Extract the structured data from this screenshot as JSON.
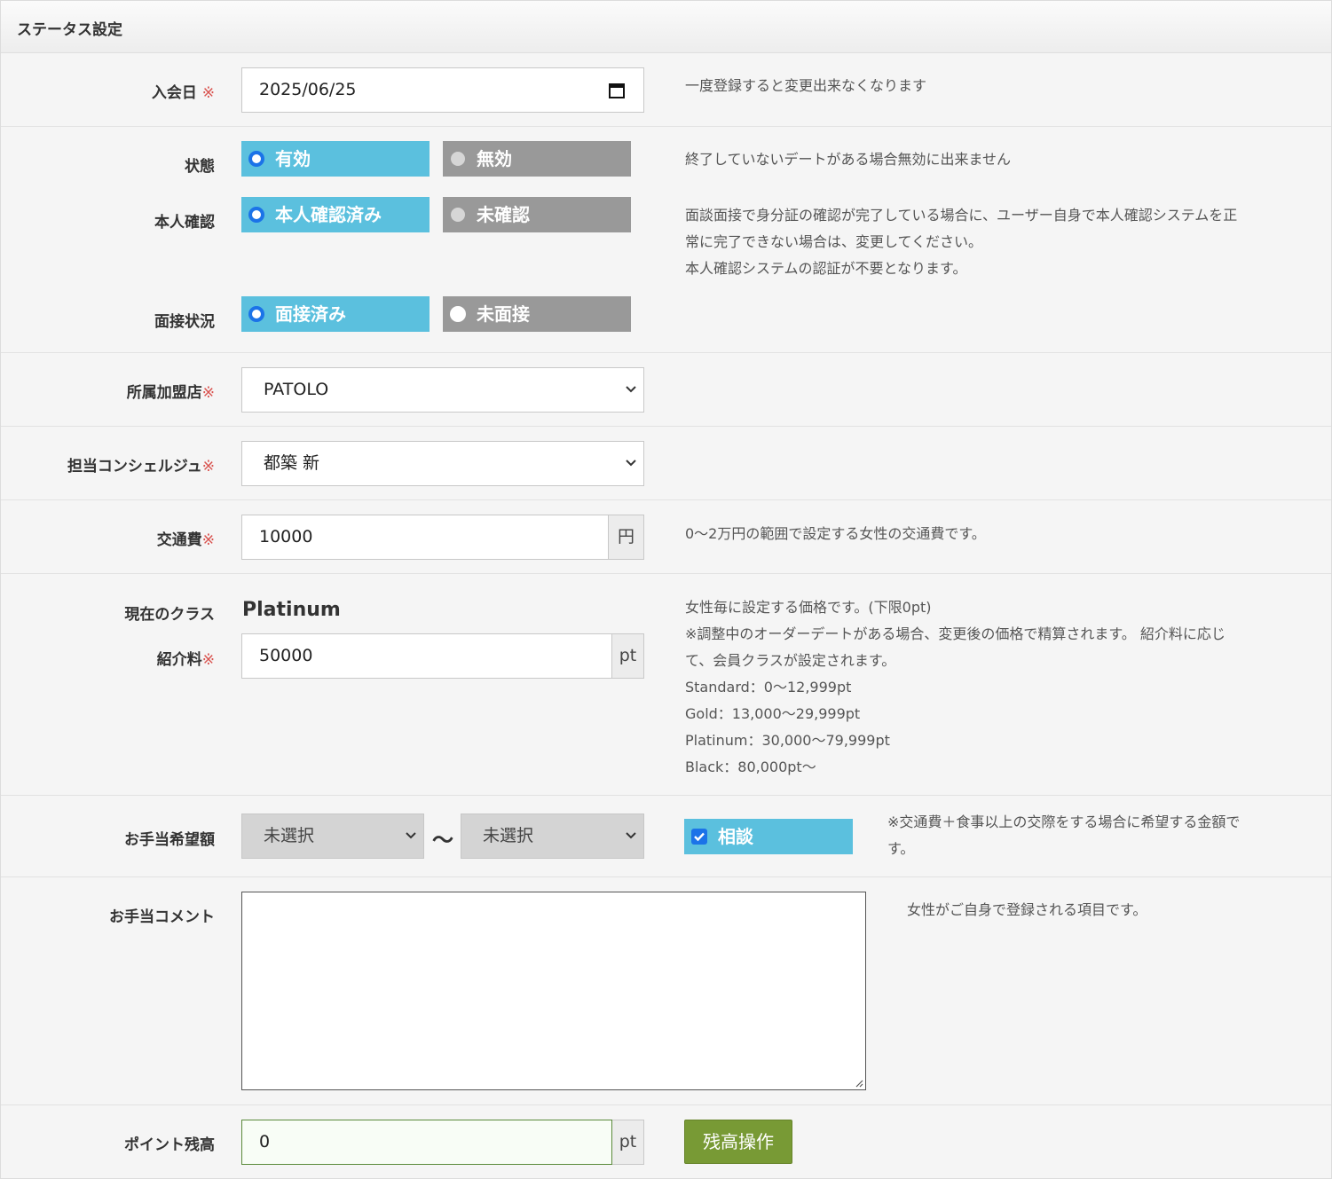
{
  "section": {
    "title": "ステータス設定"
  },
  "required_mark": "※",
  "join_date": {
    "label": "入会日",
    "value": "2025/06/25",
    "note": "一度登録すると変更出来なくなります"
  },
  "status": {
    "label": "状態",
    "options": [
      "有効",
      "無効"
    ],
    "selected": "有効",
    "note": "終了していないデートがある場合無効に出来ません"
  },
  "identity": {
    "label": "本人確認",
    "options": [
      "本人確認済み",
      "未確認"
    ],
    "selected": "本人確認済み",
    "note_lines": [
      "面談面接で身分証の確認が完了している場合に、ユーザー自身で本人確認システムを正",
      "常に完了できない場合は、変更してください。",
      "本人確認システムの認証が不要となります。"
    ]
  },
  "interview": {
    "label": "面接状況",
    "options": [
      "面接済み",
      "未面接"
    ],
    "selected": "面接済み"
  },
  "store": {
    "label": "所属加盟店",
    "value": "PATOLO"
  },
  "concierge": {
    "label": "担当コンシェルジュ",
    "value": "都築 新"
  },
  "transport": {
    "label": "交通費",
    "value": "10000",
    "unit": "円",
    "note": "0〜2万円の範囲で設定する女性の交通費です。"
  },
  "current_class": {
    "label": "現在のクラス",
    "value": "Platinum"
  },
  "fee": {
    "label": "紹介料",
    "value": "50000",
    "unit": "pt",
    "note_lines": [
      "女性毎に設定する価格です。(下限0pt)",
      "※調整中のオーダーデートがある場合、変更後の価格で精算されます。 紹介料に応じ",
      "て、会員クラスが設定されます。",
      "Standard：0〜12,999pt",
      "Gold：13,000〜29,999pt",
      "Platinum：30,000〜79,999pt",
      "Black：80,000pt〜"
    ]
  },
  "allowance": {
    "label": "お手当希望額",
    "from": "未選択",
    "separator": "〜",
    "to": "未選択",
    "consult_label": "相談",
    "consult_checked": true,
    "note_lines": [
      "※交通費＋食事以上の交際をする場合に希望する金額で",
      "す。"
    ]
  },
  "allowance_comment": {
    "label": "お手当コメント",
    "value": "",
    "note": "女性がご自身で登録される項目です。"
  },
  "points": {
    "label": "ポイント残高",
    "value": "0",
    "unit": "pt",
    "button": "残高操作"
  },
  "colors": {
    "toggle_on": "#5bc0de",
    "toggle_off": "#999999",
    "button_green": "#789a35",
    "required": "#d9534f"
  }
}
